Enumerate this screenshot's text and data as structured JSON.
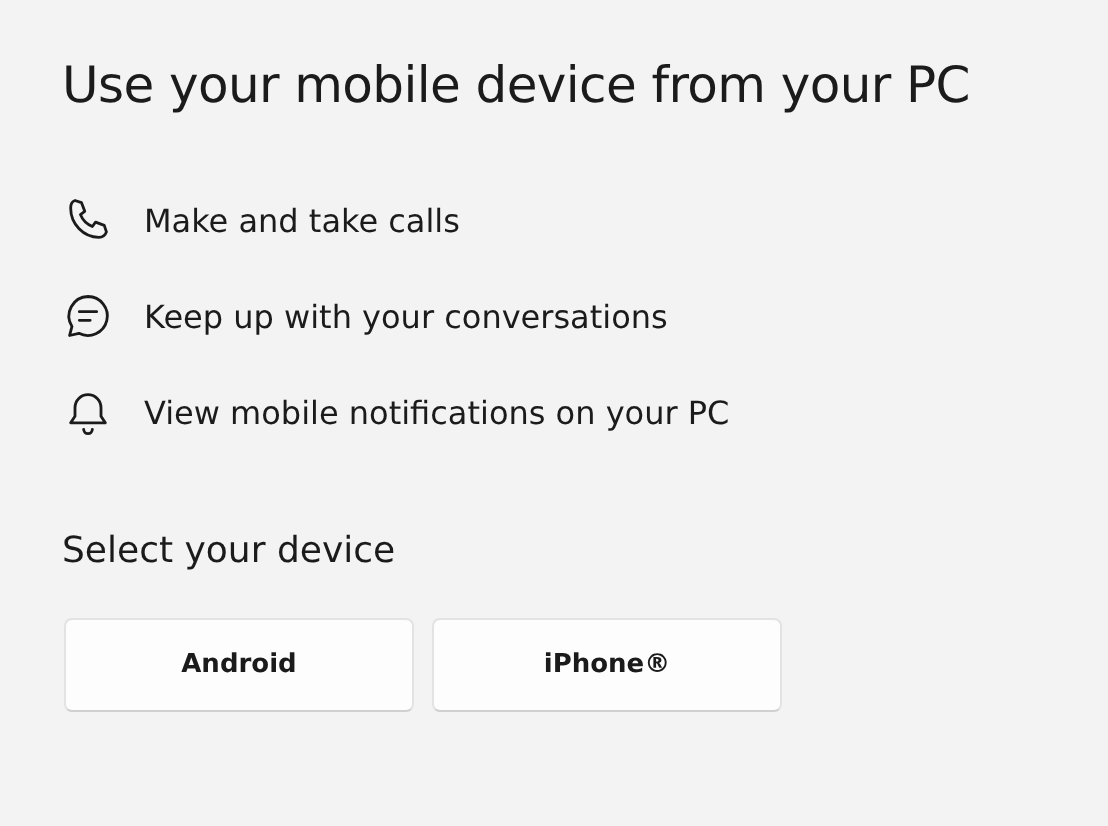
{
  "title": "Use your mobile device from your PC",
  "features": [
    {
      "kind": "phone",
      "label": "Make and take calls"
    },
    {
      "kind": "chat",
      "label": "Keep up with your conversations"
    },
    {
      "kind": "bell",
      "label": "View mobile notifications on your PC"
    }
  ],
  "device_section": {
    "heading": "Select your device",
    "buttons": [
      "Android",
      "iPhone®"
    ]
  }
}
